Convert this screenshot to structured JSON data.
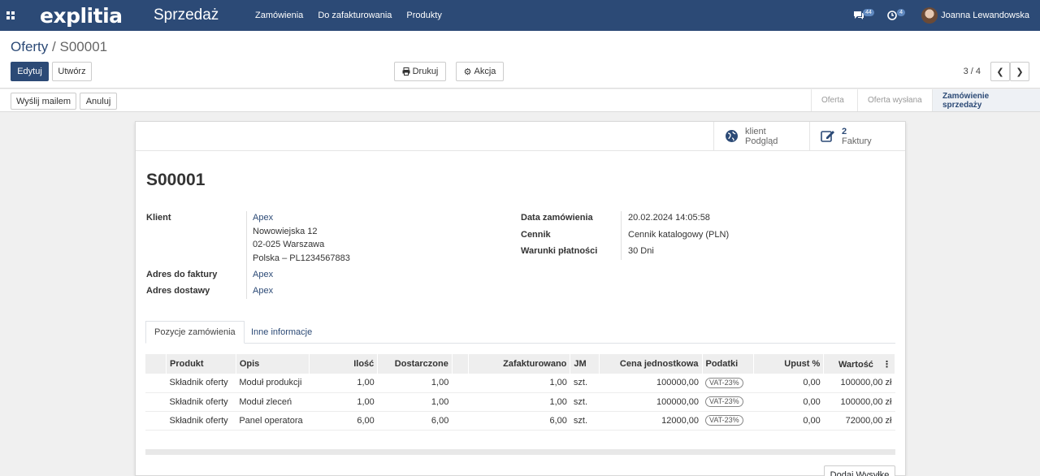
{
  "navbar": {
    "brand": "explitia",
    "app_name": "Sprzedaż",
    "menu": [
      "Zamówienia",
      "Do zafakturowania",
      "Produkty"
    ],
    "messages_count": "44",
    "activities_count": "4",
    "user_name": "Joanna Lewandowska"
  },
  "control": {
    "breadcrumb_parent": "Oferty",
    "breadcrumb_separator": "/",
    "breadcrumb_current": "S00001",
    "edit_label": "Edytuj",
    "create_label": "Utwórz",
    "print_label": "Drukuj",
    "action_label": "Akcja",
    "pager": "3 / 4"
  },
  "statusbar": {
    "send_email_label": "Wyślij mailem",
    "cancel_label": "Anuluj",
    "stages": [
      "Oferta",
      "Oferta wysłana",
      "Zamówienie sprzedaży"
    ],
    "active_stage": "Zamówienie sprzedaży"
  },
  "sheet": {
    "smart_buttons": {
      "preview_top": "klient",
      "preview_bottom": "Podgląd",
      "invoices_count": "2",
      "invoices_label": "Faktury"
    },
    "title": "S00001",
    "left_fields": {
      "customer_label": "Klient",
      "customer_name": "Apex",
      "address_line1": "Nowowiejska 12",
      "address_line2": "02-025 Warszawa",
      "address_line3": "Polska – PL1234567883",
      "invoice_address_label": "Adres do faktury",
      "invoice_address_value": "Apex",
      "delivery_address_label": "Adres dostawy",
      "delivery_address_value": "Apex"
    },
    "right_fields": {
      "order_date_label": "Data zamówienia",
      "order_date_value": "20.02.2024 14:05:58",
      "pricelist_label": "Cennik",
      "pricelist_value": "Cennik katalogowy (PLN)",
      "payment_terms_label": "Warunki płatności",
      "payment_terms_value": "30 Dni"
    },
    "tabs": [
      "Pozycje zamówienia",
      "Inne informacje"
    ],
    "table": {
      "columns": [
        "Produkt",
        "Opis",
        "Ilość",
        "Dostarczone",
        "Zafakturowano",
        "JM",
        "Cena jednostkowa",
        "Podatki",
        "Upust %",
        "Wartość"
      ],
      "rows": [
        {
          "product": "Składnik oferty",
          "desc": "Moduł produkcji",
          "qty": "1,00",
          "delivered": "1,00",
          "invoiced": "1,00",
          "uom": "szt.",
          "price": "100000,00",
          "tax": "VAT-23%",
          "discount": "0,00",
          "subtotal": "100000,00 zł"
        },
        {
          "product": "Składnik oferty",
          "desc": "Moduł zleceń",
          "qty": "1,00",
          "delivered": "1,00",
          "invoiced": "1,00",
          "uom": "szt.",
          "price": "100000,00",
          "tax": "VAT-23%",
          "discount": "0,00",
          "subtotal": "100000,00 zł"
        },
        {
          "product": "Składnik oferty",
          "desc": "Panel operatora",
          "qty": "6,00",
          "delivered": "6,00",
          "invoiced": "6,00",
          "uom": "szt.",
          "price": "12000,00",
          "tax": "VAT-23%",
          "discount": "0,00",
          "subtotal": "72000,00 zł"
        }
      ]
    },
    "add_shipping_label": "Dodaj Wysyłkę"
  }
}
